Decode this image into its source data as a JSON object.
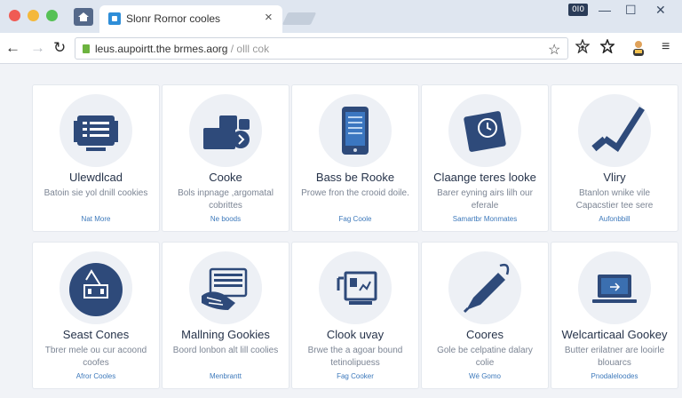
{
  "window": {
    "tab_title": "Slonr Rornor cooles",
    "tab_close": "×",
    "badge": "0I0",
    "minimize": "—",
    "maximize": "☐",
    "close": "✕"
  },
  "toolbar": {
    "back": "←",
    "forward": "→",
    "reload": "↻",
    "url": "leus.aupoirtt.the brmes.aorg",
    "url_suffix": " / olll cok",
    "bookmark_star": "☆",
    "menu": "≡"
  },
  "cards": [
    {
      "title": "Ulewdlcad",
      "desc": "Batoin sie yol dnill cookies",
      "link": "Nat More",
      "icon": "document-list-icon"
    },
    {
      "title": "Cooke",
      "desc": "Bols inpnage ,argomatal cobrittes",
      "link": "Ne boods",
      "icon": "folders-icon"
    },
    {
      "title": "Bass be Rooke",
      "desc": "Prowe fron the crooid doile.",
      "link": "Fag Coole",
      "icon": "smartphone-icon"
    },
    {
      "title": "Claange teres looke",
      "desc": "Barer eyning airs lilh our eferale",
      "link": "Samartbr Monmates",
      "icon": "clock-icon"
    },
    {
      "title": "Vliry",
      "desc": "Btanlon wnike vile Capacstier tee sere",
      "link": "Aufonbbill",
      "icon": "checkmark-icon"
    },
    {
      "title": "Seast Cones",
      "desc": "Tbrer mele ou cur acoond coofes",
      "link": "Afror Cooles",
      "icon": "shield-money-icon"
    },
    {
      "title": "Mallning Gookies",
      "desc": "Boord lonbon alt lill coolies",
      "link": "Menbrantt",
      "icon": "hand-card-icon"
    },
    {
      "title": "Clook uvay",
      "desc": "Brwe the a agoar bound tetinolipuess",
      "link": "Fag Cooker",
      "icon": "monitor-chart-icon"
    },
    {
      "title": "Coores",
      "desc": "Gole be celpatine dalary colie",
      "link": "Wé Gomo",
      "icon": "pen-icon"
    },
    {
      "title": "Welcarticaal Gookey",
      "desc": "Butter erilatner are looirle blouarcs",
      "link": "Pnodaleloodes",
      "icon": "laptop-icon"
    }
  ],
  "colors": {
    "accent": "#2e4a7a",
    "link": "#3d79bb",
    "tabstrip": "#dfe6f0",
    "background": "#f1f3f7"
  }
}
